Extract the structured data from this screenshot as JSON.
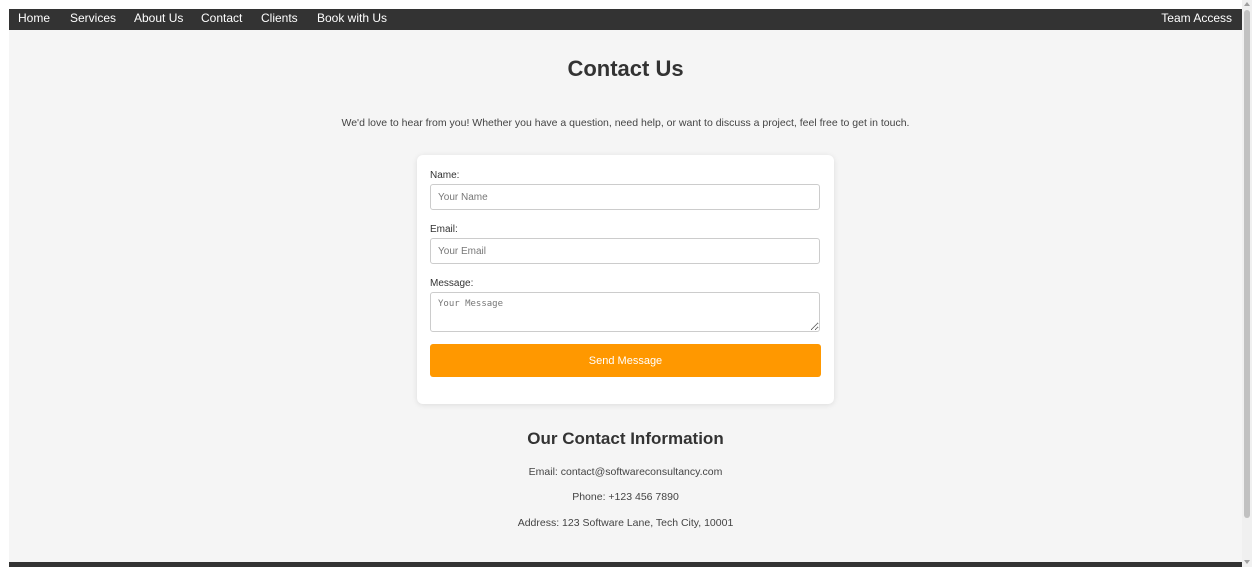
{
  "nav": {
    "home": "Home",
    "services": "Services",
    "about": "About Us",
    "contact": "Contact",
    "clients": "Clients",
    "book": "Book with Us",
    "team_access": "Team Access"
  },
  "page": {
    "title": "Contact Us",
    "intro": "We'd love to hear from you! Whether you have a question, need help, or want to discuss a project, feel free to get in touch."
  },
  "form": {
    "name_label": "Name:",
    "name_placeholder": "Your Name",
    "email_label": "Email:",
    "email_placeholder": "Your Email",
    "message_label": "Message:",
    "message_placeholder": "Your Message",
    "submit_label": "Send Message"
  },
  "contact_info": {
    "title": "Our Contact Information",
    "email": "Email: contact@softwareconsultancy.com",
    "phone": "Phone: +123 456 7890",
    "address": "Address: 123 Software Lane, Tech City, 10001"
  },
  "colors": {
    "navbar": "#333333",
    "page_background": "#f5f5f5",
    "accent": "#ff9800"
  }
}
